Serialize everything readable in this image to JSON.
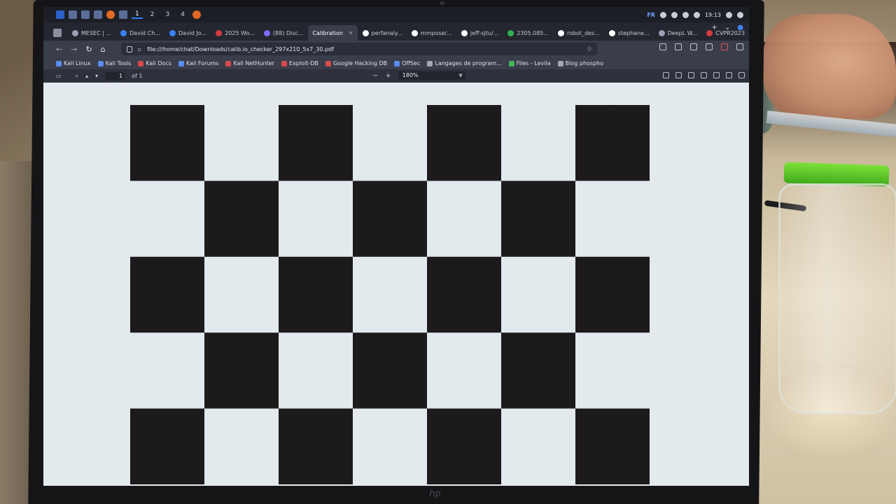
{
  "os_panel": {
    "workspaces": [
      "1",
      "2",
      "3",
      "4"
    ],
    "keyboard_layout": "FR",
    "clock": "19:13"
  },
  "tabs": [
    {
      "label": "MESEC | ...",
      "icon": "page-icon"
    },
    {
      "label": "David Ch...",
      "icon": "page-icon"
    },
    {
      "label": "David Jo...",
      "icon": "page-icon"
    },
    {
      "label": "2025 Wo...",
      "icon": "page-icon"
    },
    {
      "label": "(88) Disc...",
      "icon": "discord-icon"
    },
    {
      "label": "Calibration",
      "icon": "pdf-icon",
      "active": true
    },
    {
      "label": "perfanaly...",
      "icon": "github-icon"
    },
    {
      "label": "mmpose/...",
      "icon": "github-icon"
    },
    {
      "label": "jeff-sjtu/...",
      "icon": "github-icon"
    },
    {
      "label": "2305.085...",
      "icon": "arxiv-icon"
    },
    {
      "label": "robot_des...",
      "icon": "github-icon"
    },
    {
      "label": "stephane...",
      "icon": "github-icon"
    },
    {
      "label": "DeepL W...",
      "icon": "deepl-icon"
    },
    {
      "label": "CVPR2023",
      "icon": "youtube-icon"
    }
  ],
  "nav": {
    "url": "file:///home/chat/Downloads/calib.io_checker_297x210_5x7_30.pdf"
  },
  "bookmarks": [
    {
      "label": "Kali Linux",
      "icon": "kali-icon"
    },
    {
      "label": "Kali Tools",
      "icon": "kali-icon"
    },
    {
      "label": "Kali Docs",
      "icon": "kali-red-icon"
    },
    {
      "label": "Kali Forums",
      "icon": "kali-icon"
    },
    {
      "label": "Kali NetHunter",
      "icon": "kali-red-icon"
    },
    {
      "label": "Exploit-DB",
      "icon": "exploit-icon"
    },
    {
      "label": "Google Hacking DB",
      "icon": "ghdb-icon"
    },
    {
      "label": "OffSec",
      "icon": "offsec-icon"
    },
    {
      "label": "Langages de program...",
      "icon": "globe-icon"
    },
    {
      "label": "Files - Levila",
      "icon": "files-icon"
    },
    {
      "label": "Blog phospho",
      "icon": "blog-icon"
    }
  ],
  "pdf_toolbar": {
    "page_number": "1",
    "page_count": "of 1",
    "zoom": "180%"
  },
  "checkerboard": {
    "columns": 7,
    "rows": 5,
    "dark_color": "#1d1a1c",
    "light_color": "#e3eaee"
  }
}
